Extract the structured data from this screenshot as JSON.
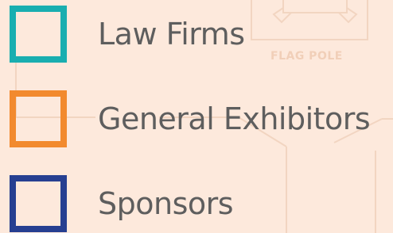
{
  "map": {
    "background_color": "#fde9dc",
    "line_color": "#f2d5c1",
    "feature_label": "FLAG POLE"
  },
  "legend": {
    "items": [
      {
        "label": "Law Firms",
        "color": "#19aeb0"
      },
      {
        "label": "General Exhibitors",
        "color": "#f28a2e"
      },
      {
        "label": "Sponsors",
        "color": "#263f91"
      }
    ]
  }
}
